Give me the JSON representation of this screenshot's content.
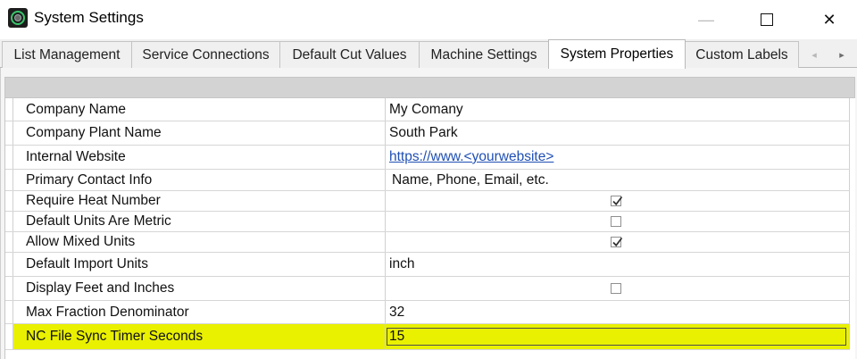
{
  "window": {
    "title": "System Settings",
    "minimize_glyph": "—",
    "close_glyph": "✕"
  },
  "tabs": [
    {
      "label": "List Management",
      "active": false
    },
    {
      "label": "Service Connections",
      "active": false
    },
    {
      "label": "Default Cut Values",
      "active": false
    },
    {
      "label": "Machine Settings",
      "active": false
    },
    {
      "label": "System Properties",
      "active": true
    },
    {
      "label": "Custom Labels",
      "active": false
    }
  ],
  "tab_scroll": {
    "left_glyph": "◂",
    "right_glyph": "▸"
  },
  "properties": [
    {
      "name": "Company Name",
      "value": "My Comany",
      "type": "text"
    },
    {
      "name": "Company Plant Name",
      "value": "South Park",
      "type": "text"
    },
    {
      "name": "Internal Website",
      "value": "https://www.<yourwebsite>",
      "type": "link"
    },
    {
      "name": "Primary Contact Info",
      "value": "Name, Phone, Email, etc.",
      "type": "text"
    },
    {
      "name": "Require Heat Number",
      "value": true,
      "type": "checkbox"
    },
    {
      "name": "Default Units Are Metric",
      "value": false,
      "type": "checkbox"
    },
    {
      "name": "Allow Mixed Units",
      "value": true,
      "type": "checkbox"
    },
    {
      "name": "Default Import Units",
      "value": "inch",
      "type": "text"
    },
    {
      "name": "Display Feet and Inches",
      "value": false,
      "type": "checkbox"
    },
    {
      "name": "Max Fraction Denominator",
      "value": "32",
      "type": "text"
    },
    {
      "name": "NC File Sync Timer Seconds",
      "value": "15",
      "type": "edit",
      "highlighted": true
    }
  ],
  "colors": {
    "highlight": "#e9f000",
    "link": "#1f4fb5",
    "header": "#d3d3d3"
  }
}
